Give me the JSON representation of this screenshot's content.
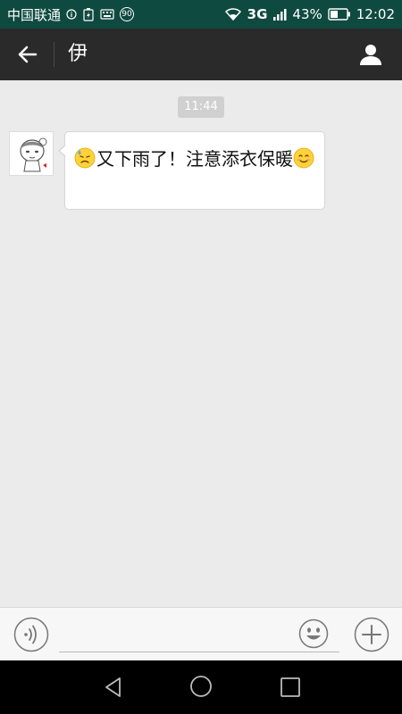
{
  "status_bar": {
    "carrier": "中国联通",
    "badge_number": "90",
    "network": "3G",
    "battery": "43%",
    "time": "12:02"
  },
  "header": {
    "title": "伊"
  },
  "chat": {
    "timestamp": "11:44",
    "message": {
      "text": "又下雨了！注意添衣保暖",
      "lead_emoji": "sad-sweat-emoji",
      "trail_emoji": "smile-emoji"
    }
  },
  "icons": {
    "back": "arrow-left-icon",
    "profile": "user-icon",
    "voice": "voice-icon",
    "emoji": "smile-icon",
    "more": "plus-icon"
  },
  "colors": {
    "status_bar": "#0f4a40",
    "title_bar": "#2a2a2a",
    "chat_background": "#ebebeb",
    "nav_bar": "#000000"
  }
}
